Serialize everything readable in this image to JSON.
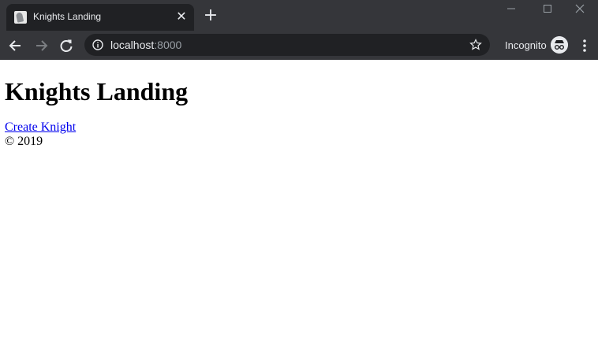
{
  "browser": {
    "tab": {
      "title": "Knights Landing",
      "close_glyph": "✕",
      "favicon": "knight-favicon"
    },
    "new_tab_glyph": "+",
    "window_controls": [
      "minimize-icon",
      "maximize-icon",
      "close-window-icon"
    ],
    "nav": {
      "back": "back-arrow-icon",
      "forward": "forward-arrow-icon",
      "reload": "reload-icon"
    },
    "omnibox": {
      "host": "localhost",
      "port": ":8000",
      "site_info_icon": "info-icon",
      "bookmark_icon": "star-icon"
    },
    "incognito_label": "Incognito",
    "menu_icon": "more-vert-icon",
    "colors": {
      "frame": "#202124",
      "toolbar": "#35363a",
      "text": "#e8eaed",
      "muted": "#9aa0a6"
    }
  },
  "page": {
    "heading": "Knights Landing",
    "create_link": "Create Knight",
    "footer": "© 2019",
    "link_color": "#0000ee"
  }
}
